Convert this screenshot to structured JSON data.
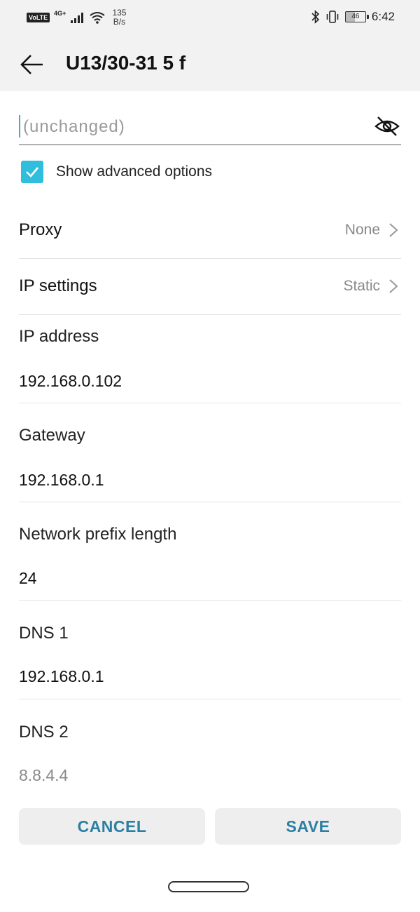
{
  "status_bar": {
    "volte": "VoLTE",
    "network": "4G+",
    "speed_value": "135",
    "speed_unit": "B/s",
    "battery_level": "46",
    "time": "6:42"
  },
  "app_bar": {
    "title": "U13/30-31 5 f"
  },
  "password": {
    "placeholder": "(unchanged)"
  },
  "advanced": {
    "label": "Show advanced options",
    "checked": true
  },
  "proxy": {
    "label": "Proxy",
    "value": "None"
  },
  "ip_settings": {
    "label": "IP settings",
    "value": "Static"
  },
  "fields": {
    "ip_address": {
      "label": "IP address",
      "value": "192.168.0.102"
    },
    "gateway": {
      "label": "Gateway",
      "value": "192.168.0.1"
    },
    "prefix": {
      "label": "Network prefix length",
      "value": "24"
    },
    "dns1": {
      "label": "DNS 1",
      "value": "192.168.0.1"
    },
    "dns2": {
      "label": "DNS 2",
      "placeholder": "8.8.4.4"
    }
  },
  "buttons": {
    "cancel": "CANCEL",
    "save": "SAVE"
  },
  "colors": {
    "accent": "#2fbfdc",
    "button_text": "#2c7fa3"
  }
}
